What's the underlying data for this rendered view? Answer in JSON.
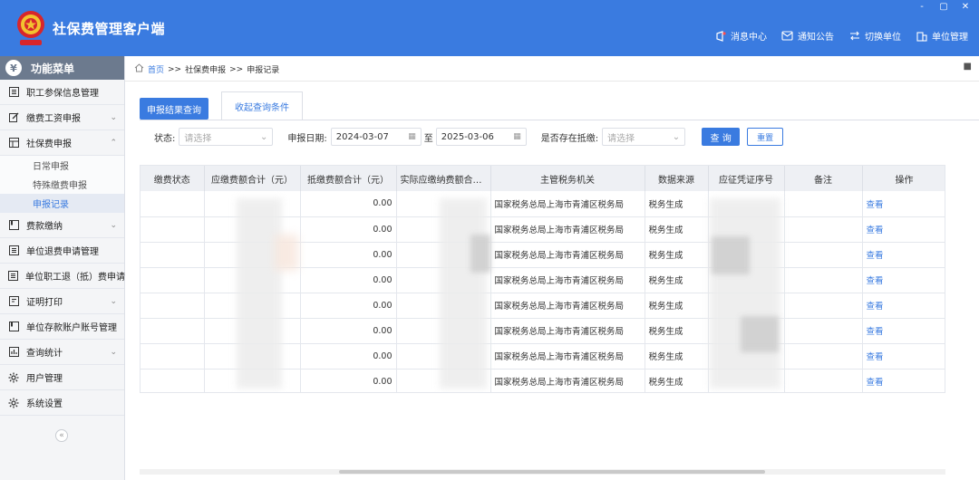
{
  "app": {
    "title": "社保费管理客户端",
    "window_controls": [
      "-",
      "▢",
      "✕"
    ]
  },
  "header_menu": [
    {
      "label": "消息中心",
      "icon": "message-icon"
    },
    {
      "label": "通知公告",
      "icon": "notice-icon"
    },
    {
      "label": "切换单位",
      "icon": "switch-icon"
    },
    {
      "label": "单位管理",
      "icon": "building-icon"
    }
  ],
  "sidebar": {
    "title": "功能菜单",
    "items": [
      {
        "label": "职工参保信息管理"
      },
      {
        "label": "缴费工资申报",
        "chevron": "⌄"
      },
      {
        "label": "社保费申报",
        "chevron": "⌃"
      },
      {
        "label": "费款缴纳",
        "chevron": "⌄"
      },
      {
        "label": "单位退费申请管理"
      },
      {
        "label": "单位职工退（抵）费申请管理"
      },
      {
        "label": "证明打印",
        "chevron": "⌄"
      },
      {
        "label": "单位存款账户账号管理"
      },
      {
        "label": "查询统计",
        "chevron": "⌄"
      },
      {
        "label": "用户管理"
      },
      {
        "label": "系统设置"
      }
    ],
    "sub_items": [
      {
        "label": "日常申报"
      },
      {
        "label": "特殊缴费申报"
      },
      {
        "label": "申报记录"
      }
    ],
    "collapse_glyph": "«"
  },
  "breadcrumb": {
    "home": "首页",
    "sep": ">>",
    "level1": "社保费申报",
    "level2": "申报记录",
    "close": "■"
  },
  "tabs": {
    "result_query": "申报结果查询",
    "collapse_query": "收起查询条件"
  },
  "filter": {
    "status_label": "状态:",
    "status_placeholder": "请选择",
    "date_label": "申报日期:",
    "date_from": "2024-03-07",
    "to_label": "至",
    "date_to": "2025-03-06",
    "offset_label": "是否存在抵缴:",
    "offset_placeholder": "请选择",
    "query_button": "查 询",
    "reset_button": "重置"
  },
  "table": {
    "columns": [
      "缴费状态",
      "应缴费额合计（元）",
      "抵缴费额合计（元）",
      "实际应缴纳费额合计（...",
      "主管税务机关",
      "数据来源",
      "应征凭证序号",
      "备注",
      "操作"
    ],
    "rows": [
      {
        "offset": "0.00",
        "authority": "国家税务总局上海市青浦区税务局",
        "source": "税务生成",
        "action": "查看"
      },
      {
        "offset": "0.00",
        "authority": "国家税务总局上海市青浦区税务局",
        "source": "税务生成",
        "action": "查看"
      },
      {
        "offset": "0.00",
        "authority": "国家税务总局上海市青浦区税务局",
        "source": "税务生成",
        "action": "查看"
      },
      {
        "offset": "0.00",
        "authority": "国家税务总局上海市青浦区税务局",
        "source": "税务生成",
        "action": "查看"
      },
      {
        "offset": "0.00",
        "authority": "国家税务总局上海市青浦区税务局",
        "source": "税务生成",
        "action": "查看"
      },
      {
        "offset": "0.00",
        "authority": "国家税务总局上海市青浦区税务局",
        "source": "税务生成",
        "action": "查看"
      },
      {
        "offset": "0.00",
        "authority": "国家税务总局上海市青浦区税务局",
        "source": "税务生成",
        "action": "查看"
      },
      {
        "offset": "0.00",
        "authority": "国家税务总局上海市青浦区税务局",
        "source": "税务生成",
        "action": "查看"
      }
    ]
  },
  "colors": {
    "primary": "#3a7be0",
    "sidebar_header": "#6c7a8e",
    "table_header": "#eef0f4"
  }
}
